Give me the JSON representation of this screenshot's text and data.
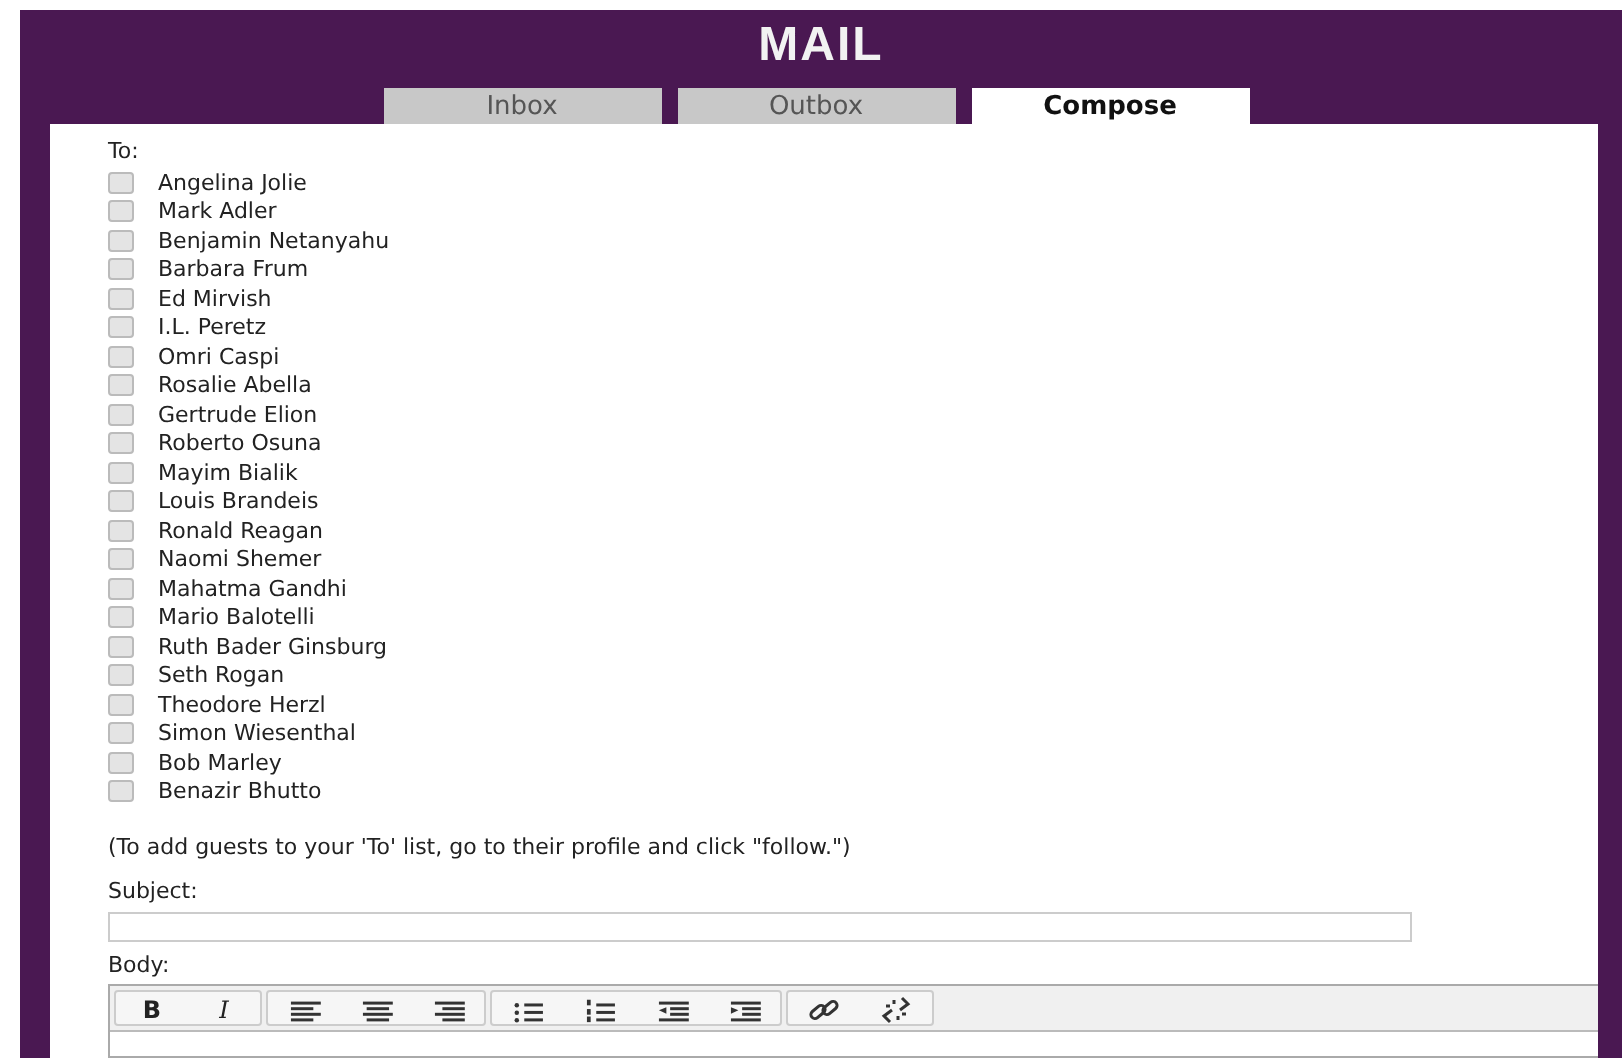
{
  "header": {
    "title": "MAIL"
  },
  "tabs": [
    {
      "label": "Inbox",
      "selected": false
    },
    {
      "label": "Outbox",
      "selected": false
    },
    {
      "label": "Compose",
      "selected": true
    }
  ],
  "compose": {
    "to_label": "To:",
    "recipients": [
      {
        "name": "Angelina Jolie",
        "checked": false
      },
      {
        "name": "Mark Adler",
        "checked": false
      },
      {
        "name": "Benjamin Netanyahu",
        "checked": false
      },
      {
        "name": "Barbara Frum",
        "checked": false
      },
      {
        "name": "Ed Mirvish",
        "checked": false
      },
      {
        "name": "I.L. Peretz",
        "checked": false
      },
      {
        "name": "Omri Caspi",
        "checked": false
      },
      {
        "name": "Rosalie Abella",
        "checked": false
      },
      {
        "name": "Gertrude Elion",
        "checked": false
      },
      {
        "name": "Roberto Osuna",
        "checked": false
      },
      {
        "name": "Mayim Bialik",
        "checked": false
      },
      {
        "name": "Louis Brandeis",
        "checked": false
      },
      {
        "name": "Ronald Reagan",
        "checked": false
      },
      {
        "name": "Naomi Shemer",
        "checked": false
      },
      {
        "name": "Mahatma Gandhi",
        "checked": false
      },
      {
        "name": "Mario Balotelli",
        "checked": false
      },
      {
        "name": "Ruth Bader Ginsburg",
        "checked": false
      },
      {
        "name": "Seth Rogan",
        "checked": false
      },
      {
        "name": "Theodore Herzl",
        "checked": false
      },
      {
        "name": "Simon Wiesenthal",
        "checked": false
      },
      {
        "name": "Bob Marley",
        "checked": false
      },
      {
        "name": "Benazir Bhutto",
        "checked": false
      }
    ],
    "hint": "(To add guests to your 'To' list, go to their profile and click \"follow.\")",
    "subject_label": "Subject:",
    "body_label": "Body:",
    "toolbar": [
      [
        {
          "kind": "bold",
          "label": "B"
        },
        {
          "kind": "italic",
          "label": "I"
        }
      ],
      [
        {
          "kind": "align-left"
        },
        {
          "kind": "align-center"
        },
        {
          "kind": "align-right"
        }
      ],
      [
        {
          "kind": "bullet-list"
        },
        {
          "kind": "numbered-list"
        },
        {
          "kind": "outdent"
        },
        {
          "kind": "indent"
        }
      ],
      [
        {
          "kind": "link"
        },
        {
          "kind": "unlink"
        }
      ]
    ]
  }
}
